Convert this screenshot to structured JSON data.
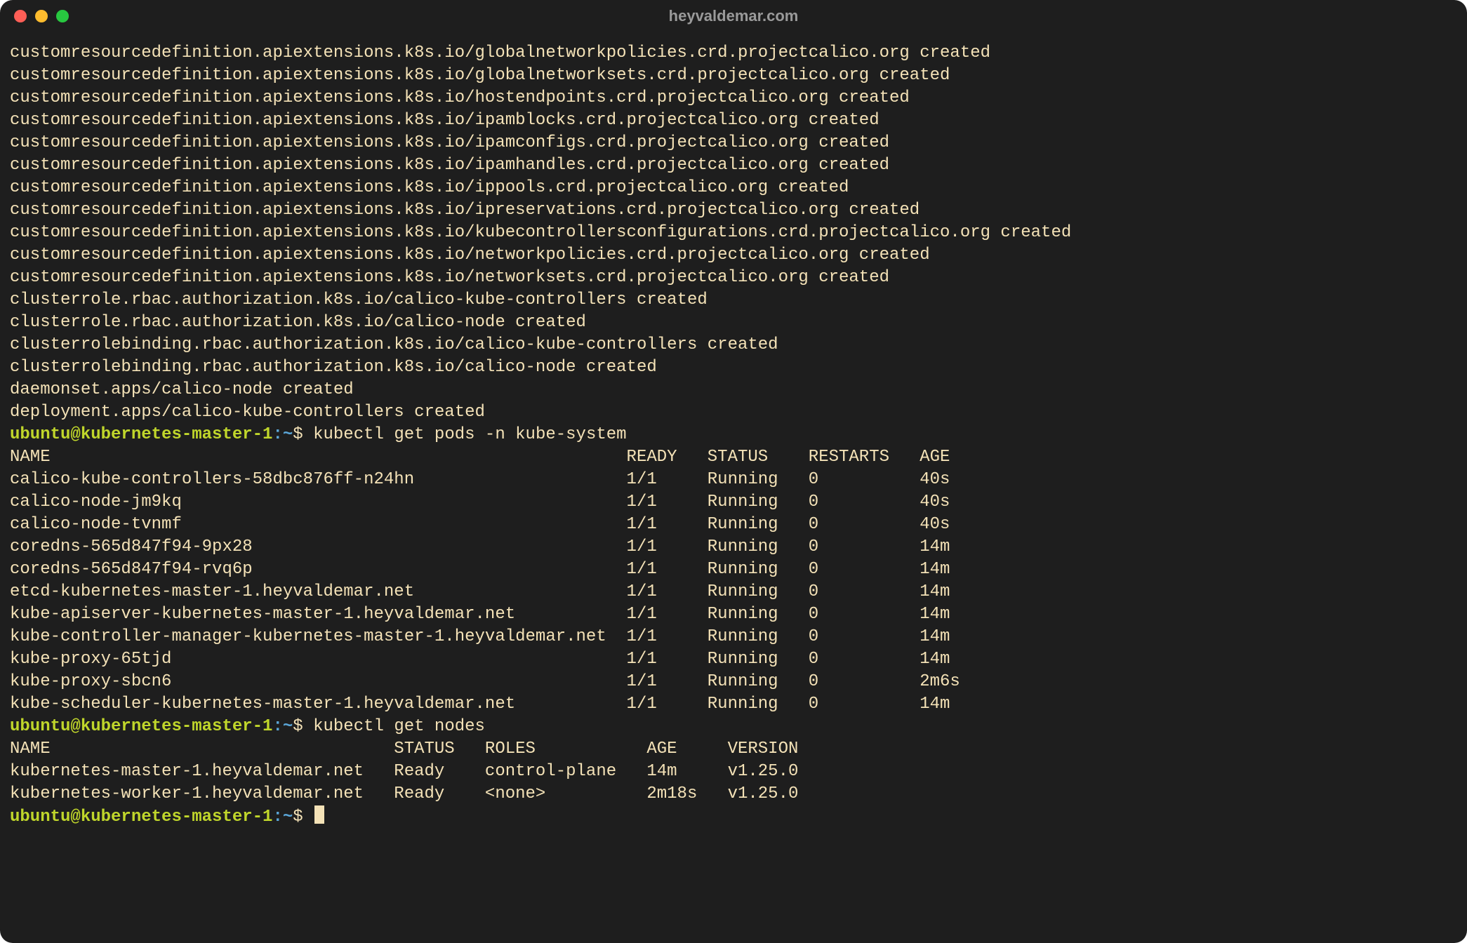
{
  "window": {
    "title": "heyvaldemar.com"
  },
  "prompt": {
    "user_host": "ubuntu@kubernetes-master-1",
    "colon": ":",
    "tilde": "~",
    "dollar": "$"
  },
  "created_lines": [
    "customresourcedefinition.apiextensions.k8s.io/globalnetworkpolicies.crd.projectcalico.org created",
    "customresourcedefinition.apiextensions.k8s.io/globalnetworksets.crd.projectcalico.org created",
    "customresourcedefinition.apiextensions.k8s.io/hostendpoints.crd.projectcalico.org created",
    "customresourcedefinition.apiextensions.k8s.io/ipamblocks.crd.projectcalico.org created",
    "customresourcedefinition.apiextensions.k8s.io/ipamconfigs.crd.projectcalico.org created",
    "customresourcedefinition.apiextensions.k8s.io/ipamhandles.crd.projectcalico.org created",
    "customresourcedefinition.apiextensions.k8s.io/ippools.crd.projectcalico.org created",
    "customresourcedefinition.apiextensions.k8s.io/ipreservations.crd.projectcalico.org created",
    "customresourcedefinition.apiextensions.k8s.io/kubecontrollersconfigurations.crd.projectcalico.org created",
    "customresourcedefinition.apiextensions.k8s.io/networkpolicies.crd.projectcalico.org created",
    "customresourcedefinition.apiextensions.k8s.io/networksets.crd.projectcalico.org created",
    "clusterrole.rbac.authorization.k8s.io/calico-kube-controllers created",
    "clusterrole.rbac.authorization.k8s.io/calico-node created",
    "clusterrolebinding.rbac.authorization.k8s.io/calico-kube-controllers created",
    "clusterrolebinding.rbac.authorization.k8s.io/calico-node created",
    "daemonset.apps/calico-node created",
    "deployment.apps/calico-kube-controllers created"
  ],
  "cmd1": "kubectl get pods -n kube-system",
  "pods_header": {
    "name": "NAME",
    "ready": "READY",
    "status": "STATUS",
    "restarts": "RESTARTS",
    "age": "AGE"
  },
  "pods": [
    {
      "name": "calico-kube-controllers-58dbc876ff-n24hn",
      "ready": "1/1",
      "status": "Running",
      "restarts": "0",
      "age": "40s"
    },
    {
      "name": "calico-node-jm9kq",
      "ready": "1/1",
      "status": "Running",
      "restarts": "0",
      "age": "40s"
    },
    {
      "name": "calico-node-tvnmf",
      "ready": "1/1",
      "status": "Running",
      "restarts": "0",
      "age": "40s"
    },
    {
      "name": "coredns-565d847f94-9px28",
      "ready": "1/1",
      "status": "Running",
      "restarts": "0",
      "age": "14m"
    },
    {
      "name": "coredns-565d847f94-rvq6p",
      "ready": "1/1",
      "status": "Running",
      "restarts": "0",
      "age": "14m"
    },
    {
      "name": "etcd-kubernetes-master-1.heyvaldemar.net",
      "ready": "1/1",
      "status": "Running",
      "restarts": "0",
      "age": "14m"
    },
    {
      "name": "kube-apiserver-kubernetes-master-1.heyvaldemar.net",
      "ready": "1/1",
      "status": "Running",
      "restarts": "0",
      "age": "14m"
    },
    {
      "name": "kube-controller-manager-kubernetes-master-1.heyvaldemar.net",
      "ready": "1/1",
      "status": "Running",
      "restarts": "0",
      "age": "14m"
    },
    {
      "name": "kube-proxy-65tjd",
      "ready": "1/1",
      "status": "Running",
      "restarts": "0",
      "age": "14m"
    },
    {
      "name": "kube-proxy-sbcn6",
      "ready": "1/1",
      "status": "Running",
      "restarts": "0",
      "age": "2m6s"
    },
    {
      "name": "kube-scheduler-kubernetes-master-1.heyvaldemar.net",
      "ready": "1/1",
      "status": "Running",
      "restarts": "0",
      "age": "14m"
    }
  ],
  "cmd2": "kubectl get nodes",
  "nodes_header": {
    "name": "NAME",
    "status": "STATUS",
    "roles": "ROLES",
    "age": "AGE",
    "version": "VERSION"
  },
  "nodes": [
    {
      "name": "kubernetes-master-1.heyvaldemar.net",
      "status": "Ready",
      "roles": "control-plane",
      "age": "14m",
      "version": "v1.25.0"
    },
    {
      "name": "kubernetes-worker-1.heyvaldemar.net",
      "status": "Ready",
      "roles": "<none>",
      "age": "2m18s",
      "version": "v1.25.0"
    }
  ],
  "cols": {
    "pods": {
      "name": 61,
      "ready": 8,
      "status": 10,
      "restarts": 11
    },
    "nodes": {
      "name": 38,
      "status": 9,
      "roles": 16,
      "age": 8
    }
  }
}
